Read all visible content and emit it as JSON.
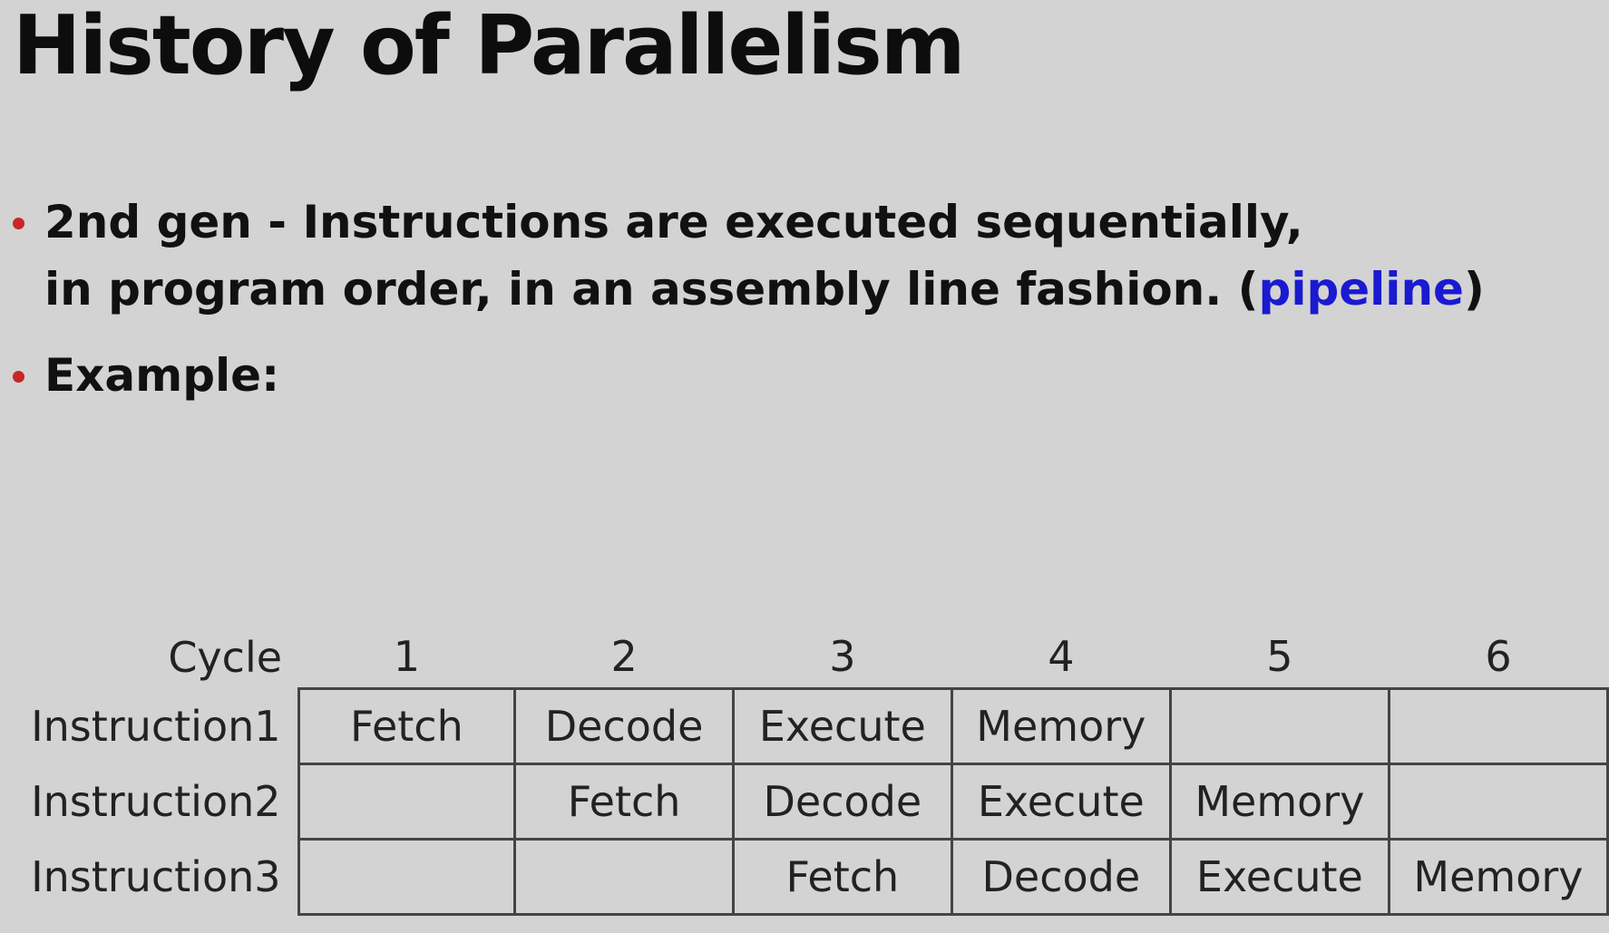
{
  "slide": {
    "title": "History of Parallelism",
    "bullets": [
      {
        "line1": "2nd gen - Instructions are executed sequentially,",
        "line2_before": "in program order, in an assembly line fashion. (",
        "line2_accent": "pipeline",
        "line2_after": ")"
      },
      {
        "text": "Example:"
      }
    ],
    "accent_color": "#1a1ad0",
    "bullet_color": "#c62828"
  },
  "pipeline_table": {
    "corner_label": "Cycle",
    "cycles": [
      "1",
      "2",
      "3",
      "4",
      "5",
      "6"
    ],
    "rows": [
      {
        "label": "Instruction1",
        "cells": [
          "Fetch",
          "Decode",
          "Execute",
          "Memory",
          "",
          ""
        ]
      },
      {
        "label": "Instruction2",
        "cells": [
          "",
          "Fetch",
          "Decode",
          "Execute",
          "Memory",
          ""
        ]
      },
      {
        "label": "Instruction3",
        "cells": [
          "",
          "",
          "Fetch",
          "Decode",
          "Execute",
          "Memory"
        ]
      }
    ]
  }
}
